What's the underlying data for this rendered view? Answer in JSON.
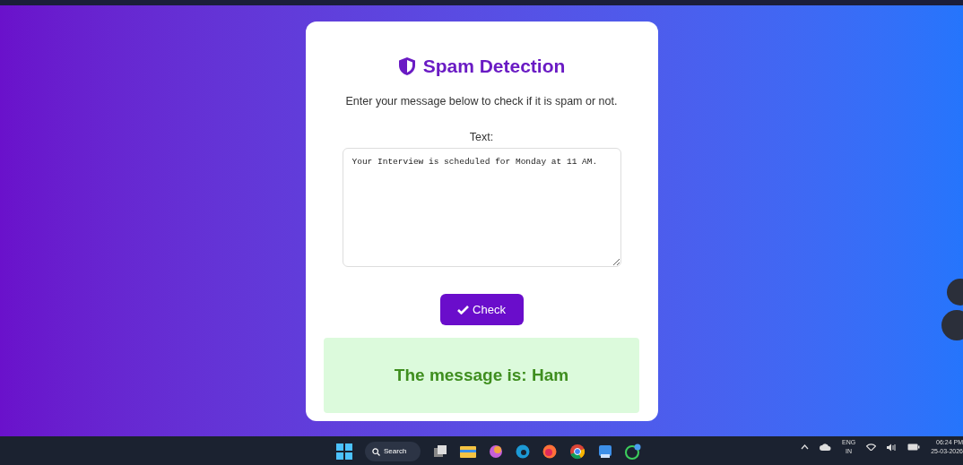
{
  "app": {
    "title": "Spam Detection",
    "instruction": "Enter your message below to check if it is spam or not.",
    "field_label": "Text:",
    "message": "Your Interview is scheduled for Monday at 11 AM.",
    "button": "Check",
    "result": "The message is: Ham"
  },
  "taskbar": {
    "search": "Search",
    "language": "ENG",
    "region": "IN",
    "time": "06:24 PM",
    "date": "25-03-2026"
  }
}
